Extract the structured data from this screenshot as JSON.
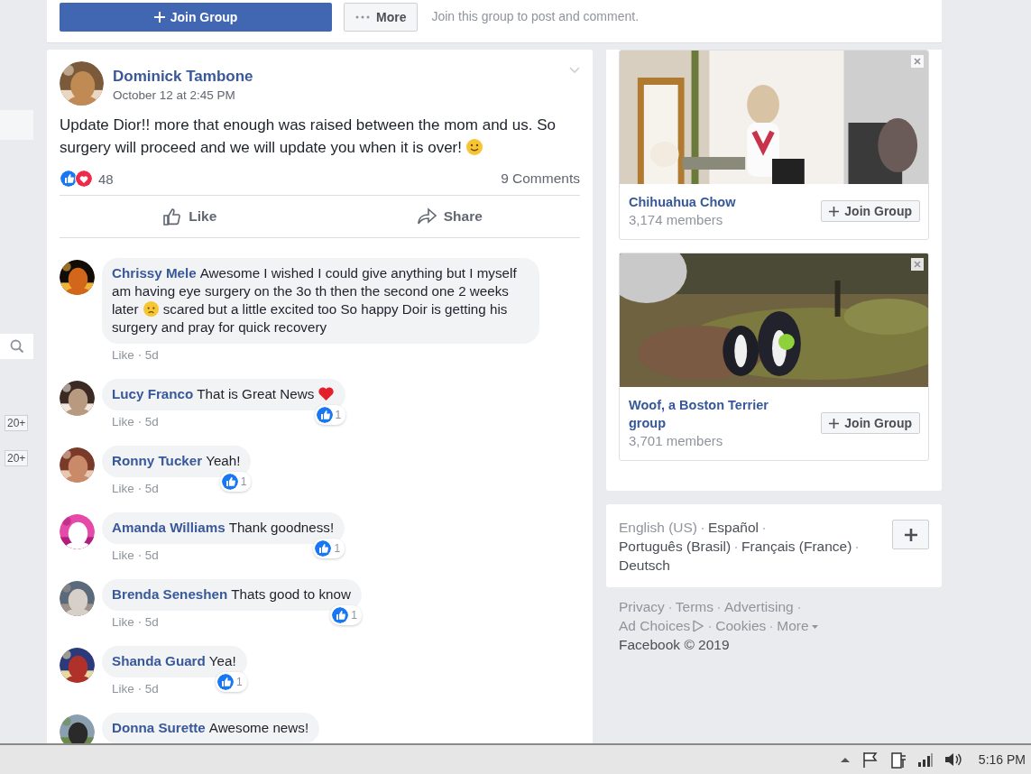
{
  "group_bar": {
    "join_button": "Join Group",
    "more_button": "More",
    "hint": "Join this group to post and comment."
  },
  "sidebar": {
    "badges": [
      "20+",
      "20+"
    ]
  },
  "post": {
    "author": "Dominick Tambone",
    "time": "October 12 at 2:45 PM",
    "text": "Update Dior!! more that enough was raised between the mom and us. So surgery will proceed and we will update you when it is over!",
    "emoji": {
      "kind": "smile"
    },
    "reactions": [
      {
        "kind": "like"
      },
      {
        "kind": "love"
      }
    ],
    "reaction_count": "48",
    "comments_count": "9 Comments",
    "actions": [
      {
        "kind": "like",
        "label": "Like"
      },
      {
        "kind": "share",
        "label": "Share"
      }
    ]
  },
  "comments": [
    {
      "author": "Chrissy Mele",
      "text": "Awesome I wished I could give anything but I myself am having eye surgery on the 3o th then the second one 2 weeks later",
      "emoji": {
        "kind": "worried"
      },
      "text_after": "scared but a little excited too So happy Doir is getting his surgery and pray for quick recovery",
      "like": "Like",
      "age": "5d"
    },
    {
      "author": "Lucy Franco",
      "text": "That is Great News",
      "emoji": {
        "kind": "heart"
      },
      "like": "Like",
      "age": "5d",
      "reaction": {
        "kind": "like",
        "count": "1"
      }
    },
    {
      "author": "Ronny Tucker",
      "text": "Yeah!",
      "like": "Like",
      "age": "5d",
      "reaction": {
        "kind": "like",
        "count": "1"
      }
    },
    {
      "author": "Amanda Williams",
      "text": "Thank goodness!",
      "like": "Like",
      "age": "5d",
      "reaction": {
        "kind": "like",
        "count": "1"
      }
    },
    {
      "author": "Brenda Seneshen",
      "text": "Thats good to know",
      "like": "Like",
      "age": "5d",
      "reaction": {
        "kind": "like",
        "count": "1"
      }
    },
    {
      "author": "Shanda Guard",
      "text": "Yea!",
      "like": "Like",
      "age": "5d",
      "reaction": {
        "kind": "like",
        "count": "1"
      }
    },
    {
      "author": "Donna Surette",
      "text": "Awesome news!"
    }
  ],
  "suggested_groups": [
    {
      "kind": "picture",
      "name": "Chihuahua Chow",
      "members": "3,174 members",
      "button": "Join Group"
    },
    {
      "kind": "picture",
      "name": "Woof, a Boston Terrier group",
      "members": "3,701 members",
      "button": "Join Group"
    }
  ],
  "languages": [
    {
      "label": "English (US)",
      "selected": true
    },
    {
      "label": "Español",
      "selected": false
    },
    {
      "label": "Português (Brasil)",
      "selected": false
    },
    {
      "label": "Français (France)",
      "selected": false
    },
    {
      "label": "Deutsch",
      "selected": false
    }
  ],
  "footer": {
    "links": [
      {
        "label": "Privacy",
        "kind": "plain"
      },
      {
        "label": "Terms",
        "kind": "plain"
      },
      {
        "label": "Advertising",
        "kind": "plain"
      },
      {
        "label": "Ad Choices",
        "kind": "adchoices"
      },
      {
        "label": "Cookies",
        "kind": "plain"
      },
      {
        "label": "More",
        "kind": "menu"
      }
    ],
    "copyright": "Facebook © 2019"
  },
  "taskbar": {
    "time": "5:16 PM"
  }
}
